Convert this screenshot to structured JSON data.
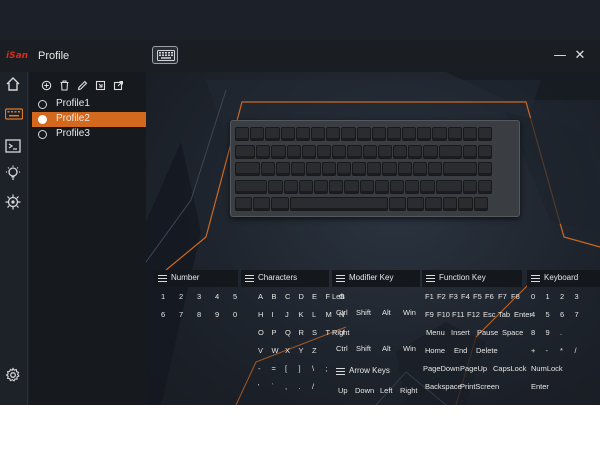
{
  "window": {
    "logo_text": "iSan",
    "title": "Profile",
    "minimize_glyph": "—",
    "close_glyph": "✕",
    "icons": [
      "keyboard-icon",
      "minimize-icon",
      "close-icon"
    ]
  },
  "rail": {
    "icons": [
      "home-icon",
      "keyboard-icon",
      "macro-icon",
      "lighting-icon",
      "settings-chip-icon",
      "gear-icon"
    ]
  },
  "profiles": {
    "toolbar_icons": [
      "add-icon",
      "delete-icon",
      "edit-icon",
      "import-icon",
      "export-icon"
    ],
    "items": [
      "Profile1",
      "Profile2",
      "Profile3"
    ],
    "active_index": 1
  },
  "colors": {
    "accent": "#d2691e",
    "logo": "#d62a1a"
  },
  "sections": {
    "number": {
      "title": "Number",
      "rows": [
        [
          "1",
          "2",
          "3",
          "4",
          "5"
        ],
        [
          "6",
          "7",
          "8",
          "9",
          "0"
        ]
      ]
    },
    "characters": {
      "title": "Characters",
      "rows": [
        [
          "A",
          "B",
          "C",
          "D",
          "E",
          "F",
          "G"
        ],
        [
          "H",
          "I",
          "J",
          "K",
          "L",
          "M",
          "N"
        ],
        [
          "O",
          "P",
          "Q",
          "R",
          "S",
          "T",
          "U"
        ],
        [
          "V",
          "W",
          "X",
          "Y",
          "Z"
        ],
        [
          "-",
          "=",
          "[",
          "]",
          "\\",
          ";"
        ],
        [
          "'",
          "`",
          ",",
          ".",
          "/"
        ]
      ]
    },
    "modifier": {
      "title": "Modifier Key",
      "left_label": "Left",
      "left_keys": [
        "Ctrl",
        "Shift",
        "Alt",
        "Win"
      ],
      "right_label": "Right",
      "right_keys": [
        "Ctrl",
        "Shift",
        "Alt",
        "Win"
      ]
    },
    "arrow": {
      "title": "Arrow Keys",
      "keys": [
        "Up",
        "Down",
        "Left",
        "Right"
      ]
    },
    "function": {
      "title": "Function Key",
      "rows": [
        [
          "F1",
          "F2",
          "F3",
          "F4",
          "F5",
          "F6",
          "F7",
          "F8"
        ],
        [
          "F9",
          "F10",
          "F11",
          "F12",
          "Esc",
          "Tab",
          "Enter"
        ],
        [
          "Menu",
          "Insert",
          "Pause",
          "Space"
        ],
        [
          "Home",
          "End",
          "Delete"
        ],
        [
          "PageDown",
          "PageUp",
          "CapsLock"
        ],
        [
          "Backspace",
          "PrintScreen"
        ]
      ]
    },
    "keyboard": {
      "title": "Keyboard",
      "rows": [
        [
          "0",
          "1",
          "2",
          "3"
        ],
        [
          "4",
          "5",
          "6",
          "7"
        ],
        [
          "8",
          "9",
          "."
        ],
        [
          "+",
          "-",
          "*",
          "/"
        ],
        [
          "NumLock"
        ],
        [
          "Enter"
        ]
      ]
    }
  }
}
